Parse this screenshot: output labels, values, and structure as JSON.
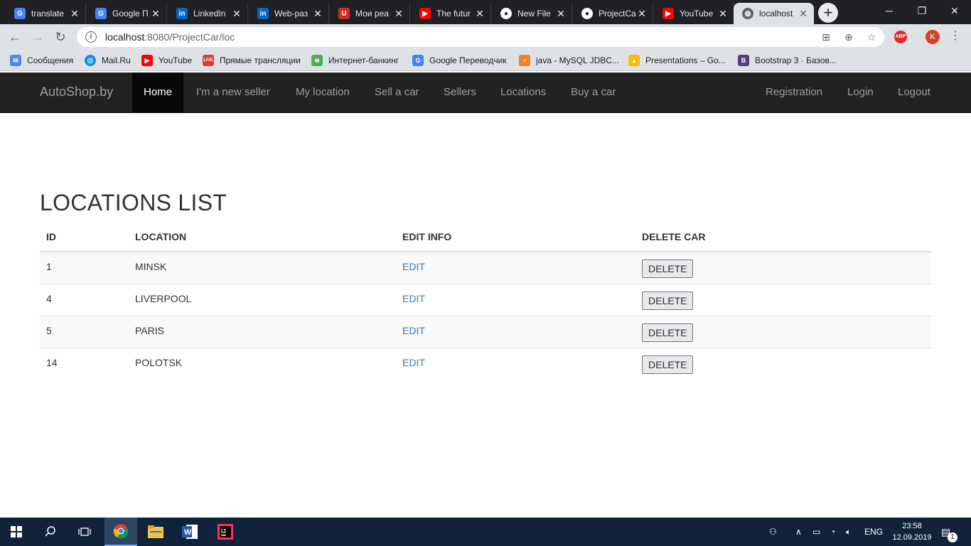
{
  "browser": {
    "tabs": [
      {
        "label": "translate",
        "icon": "google-translate-icon",
        "color": "#4285f4"
      },
      {
        "label": "Google П",
        "icon": "google-translate-icon",
        "color": "#4285f4"
      },
      {
        "label": "LinkedIn",
        "icon": "linkedin-icon",
        "color": "#0a66c2"
      },
      {
        "label": "Web-раз",
        "icon": "linkedin-icon",
        "color": "#0a66c2"
      },
      {
        "label": "Мои реа",
        "icon": "shield-icon",
        "color": "#d52b1e"
      },
      {
        "label": "The futur",
        "icon": "youtube-icon",
        "color": "#ff0000"
      },
      {
        "label": "New File",
        "icon": "github-icon",
        "color": "#ffffff"
      },
      {
        "label": "ProjectCa",
        "icon": "github-icon",
        "color": "#ffffff"
      },
      {
        "label": "YouTube",
        "icon": "youtube-icon",
        "color": "#ff0000"
      },
      {
        "label": "localhost",
        "icon": "globe-icon",
        "color": "#5f6368"
      }
    ],
    "address": {
      "host": "localhost",
      "path": ":8080/ProjectCar/loc"
    },
    "profile_initial": "K",
    "abp_label": "ABP",
    "bookmarks": [
      {
        "label": "Сообщения",
        "color": "#4a8af4"
      },
      {
        "label": "Mail.Ru",
        "color": "#168de2"
      },
      {
        "label": "YouTube",
        "color": "#ff0000"
      },
      {
        "label": "Прямые трансляции",
        "color": "#e53935"
      },
      {
        "label": "Интернет-банкинг",
        "color": "#4caf50"
      },
      {
        "label": "Google Переводчик",
        "color": "#4285f4"
      },
      {
        "label": "java - MySQL JDBC...",
        "color": "#f48024"
      },
      {
        "label": "Presentations – Go...",
        "color": "#fbbc04"
      },
      {
        "label": "Bootstrap 3 · Базов...",
        "color": "#563d7c"
      }
    ]
  },
  "navbar": {
    "brand": "AutoShop.by",
    "links": [
      "Home",
      "I'm a new seller",
      "My location",
      "Sell a car",
      "Sellers",
      "Locations",
      "Buy a car"
    ],
    "right_links": [
      "Registration",
      "Login",
      "Logout"
    ]
  },
  "page": {
    "title": "LOCATIONS LIST",
    "columns": [
      "ID",
      "LOCATION",
      "EDIT INFO",
      "DELETE CAR"
    ],
    "rows": [
      {
        "id": "1",
        "location": "MINSK",
        "edit": "EDIT",
        "delete": "DELETE"
      },
      {
        "id": "4",
        "location": "LIVERPOOL",
        "edit": "EDIT",
        "delete": "DELETE"
      },
      {
        "id": "5",
        "location": "PARIS",
        "edit": "EDIT",
        "delete": "DELETE"
      },
      {
        "id": "14",
        "location": "POLOTSK",
        "edit": "EDIT",
        "delete": "DELETE"
      }
    ]
  },
  "taskbar": {
    "language": "ENG",
    "time": "23:58",
    "date": "12.09.2019",
    "notifications": "1"
  }
}
